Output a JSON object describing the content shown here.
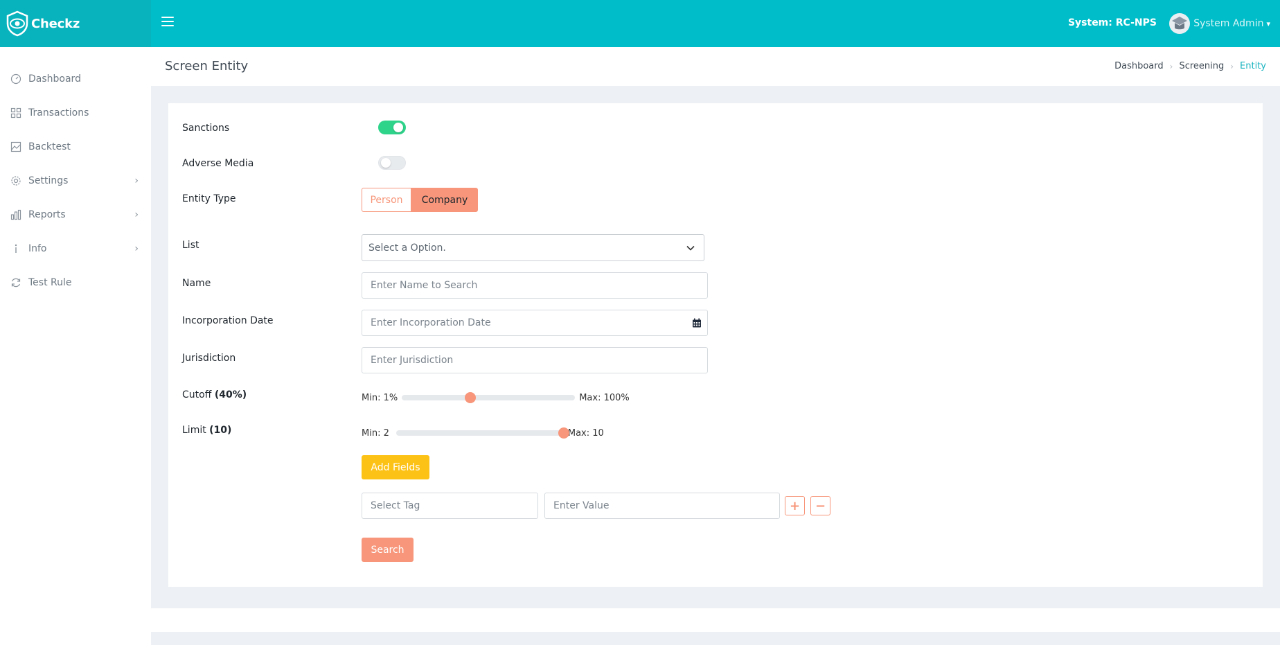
{
  "brand": {
    "name": "Checkz"
  },
  "header": {
    "system_label": "System: RC-NPS",
    "user_name": "System Admin"
  },
  "sidebar": {
    "items": [
      {
        "label": "Dashboard",
        "icon": "gauge-icon"
      },
      {
        "label": "Transactions",
        "icon": "grid-icon"
      },
      {
        "label": "Backtest",
        "icon": "image-chart-icon"
      },
      {
        "label": "Settings",
        "icon": "gear-icon",
        "expandable": true
      },
      {
        "label": "Reports",
        "icon": "bar-chart-icon",
        "expandable": true
      },
      {
        "label": "Info",
        "icon": "info-icon",
        "expandable": true
      },
      {
        "label": "Test Rule",
        "icon": "refresh-icon"
      }
    ]
  },
  "page": {
    "title": "Screen Entity",
    "breadcrumb": [
      "Dashboard",
      "Screening",
      "Entity"
    ]
  },
  "form": {
    "sanctions": {
      "label": "Sanctions",
      "enabled": true
    },
    "adverse_media": {
      "label": "Adverse Media",
      "enabled": false
    },
    "entity_type": {
      "label": "Entity Type",
      "options": [
        "Person",
        "Company"
      ],
      "selected": "Company"
    },
    "list": {
      "label": "List",
      "value": "Select a Option."
    },
    "name": {
      "label": "Name",
      "placeholder": "Enter Name to Search"
    },
    "incorporation_date": {
      "label": "Incorporation Date",
      "placeholder": "Enter Incorporation Date"
    },
    "jurisdiction": {
      "label": "Jurisdiction",
      "placeholder": "Enter Jurisdiction"
    },
    "cutoff": {
      "label": "Cutoff",
      "value_text": "(40%)",
      "min_text": "Min: 1%",
      "max_text": "Max: 100%",
      "min": 1,
      "max": 100,
      "value": 40
    },
    "limit": {
      "label": "Limit",
      "value_text": "(10)",
      "min_text": "Min: 2",
      "max_text": "Max: 10",
      "min": 2,
      "max": 10,
      "value": 10
    },
    "add_fields_label": "Add Fields",
    "tag_placeholder": "Select Tag",
    "value_placeholder": "Enter Value",
    "search_label": "Search"
  },
  "colors": {
    "header": "#00bec9",
    "accent": "#f7967a",
    "toggle_on": "#2fd48b",
    "add_button": "#fdc216"
  }
}
